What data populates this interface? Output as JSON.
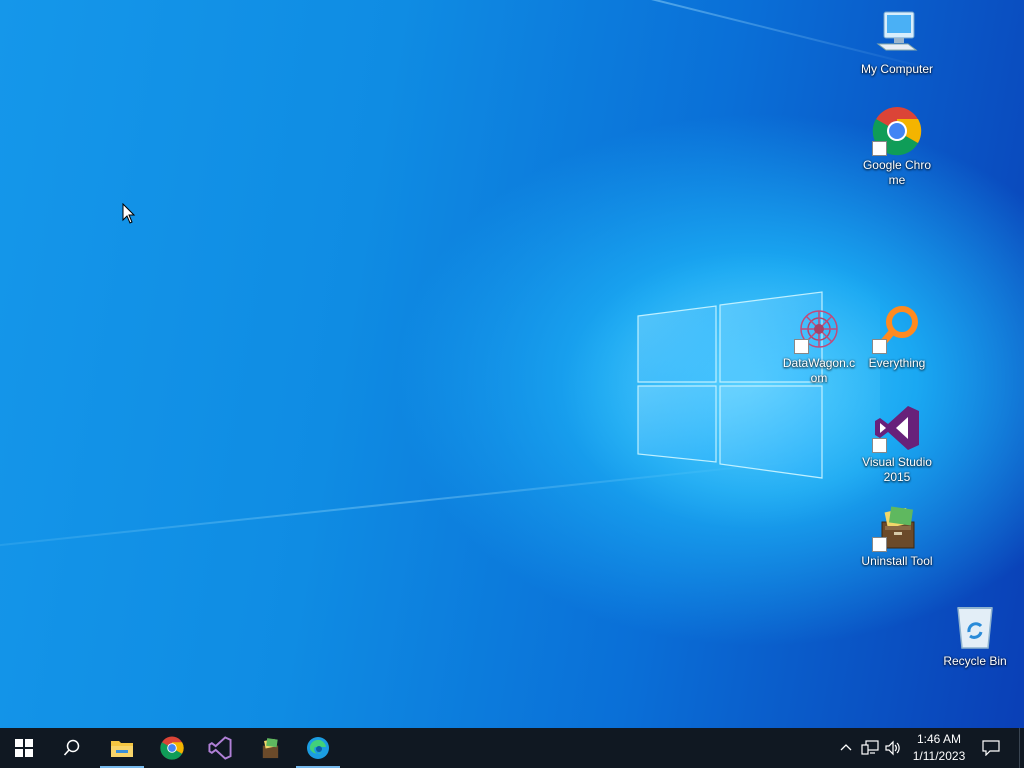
{
  "desktop": {
    "icons": [
      {
        "label": "My Computer"
      },
      {
        "label": "Google Chrome"
      },
      {
        "label": "DataWagon.com"
      },
      {
        "label": "Everything"
      },
      {
        "label": "Visual Studio 2015"
      },
      {
        "label": "Uninstall Tool"
      },
      {
        "label": "Recycle Bin"
      }
    ]
  },
  "taskbar": {
    "pinned": [
      {
        "icon": "start-windows-icon"
      },
      {
        "icon": "search-icon"
      },
      {
        "icon": "file-explorer-icon"
      },
      {
        "icon": "chrome-icon"
      },
      {
        "icon": "visual-studio-icon"
      },
      {
        "icon": "uninstall-tool-icon"
      },
      {
        "icon": "edge-icon"
      }
    ],
    "clock": {
      "time": "1:46 AM",
      "date": "1/11/2023"
    }
  },
  "colors": {
    "taskbar_bg": "#101822",
    "desktop_accent": "#0f8ce3",
    "active_indicator": "#76b9ed"
  }
}
